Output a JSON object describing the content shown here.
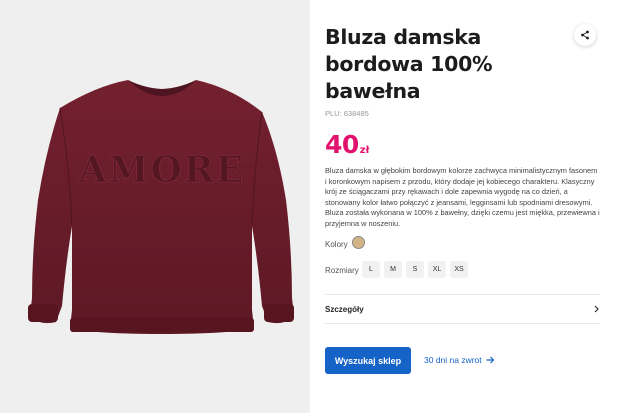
{
  "product": {
    "title": "Bluza damska bordowa 100% bawełna",
    "plu": "PLU: 638485",
    "price_amount": "40",
    "price_currency": "zł",
    "description": "Bluza damska w głębokim bordowym kolorze zachwyca minimalistycznym fasonem i koronkowym napisem z przodu, który dodaje jej kobiecego charakteru. Klasyczny krój ze ściągaczami przy rękawach i dole zapewnia wygodę na co dzień, a stonowany kolor łatwo połączyć z jeansami, legginsami lub spodniami dresowymi. Bluza została wykonana w 100% z bawełny, dzięki czemu jest miękka, przewiewna i przyjemna w noszeniu.",
    "image_text": "AMORE",
    "garment_color": "#6b1c2a"
  },
  "colors": {
    "label": "Kolory",
    "swatch_color": "#d2b488"
  },
  "sizes": {
    "label": "Rozmiary",
    "options": [
      "L",
      "M",
      "S",
      "XL",
      "XS"
    ]
  },
  "details": {
    "label": "Szczegóły",
    "icon": "chevron-right-icon"
  },
  "actions": {
    "search_store_label": "Wyszukaj sklep",
    "returns_label": "30 dni na zwrot",
    "returns_icon": "arrow-right-icon",
    "share_icon": "share-icon"
  },
  "theme": {
    "accent": "#1563c6",
    "price_color": "#e2136e",
    "gallery_bg": "#efefef"
  }
}
